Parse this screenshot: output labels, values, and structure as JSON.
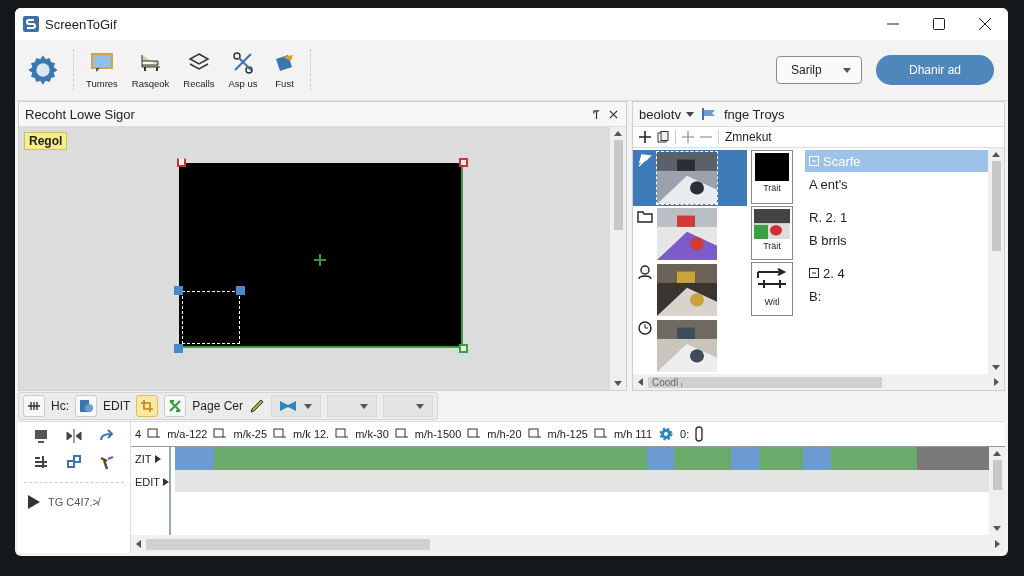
{
  "window": {
    "title": "ScreenToGif"
  },
  "toolbar": {
    "tools": [
      {
        "kind": "monitor",
        "label": "Tumres"
      },
      {
        "kind": "keyboard",
        "label": "Rasqeok"
      },
      {
        "kind": "layers",
        "label": "Recalls"
      },
      {
        "kind": "scissors",
        "label": "Asp us"
      },
      {
        "kind": "paint",
        "label": "Fust"
      }
    ],
    "mode_select": "Sarilp",
    "primary_button": "Dhanir ad"
  },
  "editor_panel": {
    "title": "Recoht Lowe Sigor",
    "tag": "Regol"
  },
  "frames_panel": {
    "view_menu": "beolotv",
    "title": "fnge Troys",
    "toolbar_label": "Zmnekut",
    "scroll_label": "Coodl ᵢ",
    "rows": [
      {
        "kind": "pinned",
        "selected": true,
        "caption": "Träit",
        "line_1": "Scarfe",
        "boxed": true,
        "line_2": "A ent's"
      },
      {
        "kind": "folder",
        "selected": false,
        "caption": "Träit",
        "line_1": "R. 2. 1",
        "boxed": false,
        "line_2": "B brrls"
      },
      {
        "kind": "person",
        "selected": false,
        "caption": "Witl",
        "line_1": "2. 4",
        "boxed": true,
        "line_2": "B:"
      },
      {
        "kind": "clock",
        "selected": false
      }
    ]
  },
  "edit_toolbar": {
    "label_1": "Hc:",
    "label_2": "EDIT",
    "label_3": "Page Cer",
    "toggles": [
      {
        "selected": false
      },
      {
        "selected": false
      },
      {
        "selected": true
      },
      {
        "selected": false
      }
    ]
  },
  "timeline": {
    "ruler_start": "4",
    "ruler_labels": [
      "m/a-122",
      "m/k-25",
      "m/k 12.",
      "m/k-30",
      "m/h-1500",
      "m/h-20",
      "m/h-125",
      "m/h 111"
    ],
    "ruler_end": "0:",
    "play_label": "TG C4I7.≯",
    "tracks": [
      {
        "label": "ZIT"
      },
      {
        "label": "EDIT"
      }
    ],
    "segments": [
      {
        "color": "#6b9bd0"
      },
      {
        "color": "#6aaa6a"
      },
      {
        "color": "#6b9bd0"
      },
      {
        "color": "#6aaa6a"
      },
      {
        "color": "#6b9bd0"
      },
      {
        "color": "#6aaa6a"
      },
      {
        "color": "#6b9bd0"
      },
      {
        "color": "#6aaa6a"
      },
      {
        "color": "#7a7a7a"
      }
    ]
  }
}
